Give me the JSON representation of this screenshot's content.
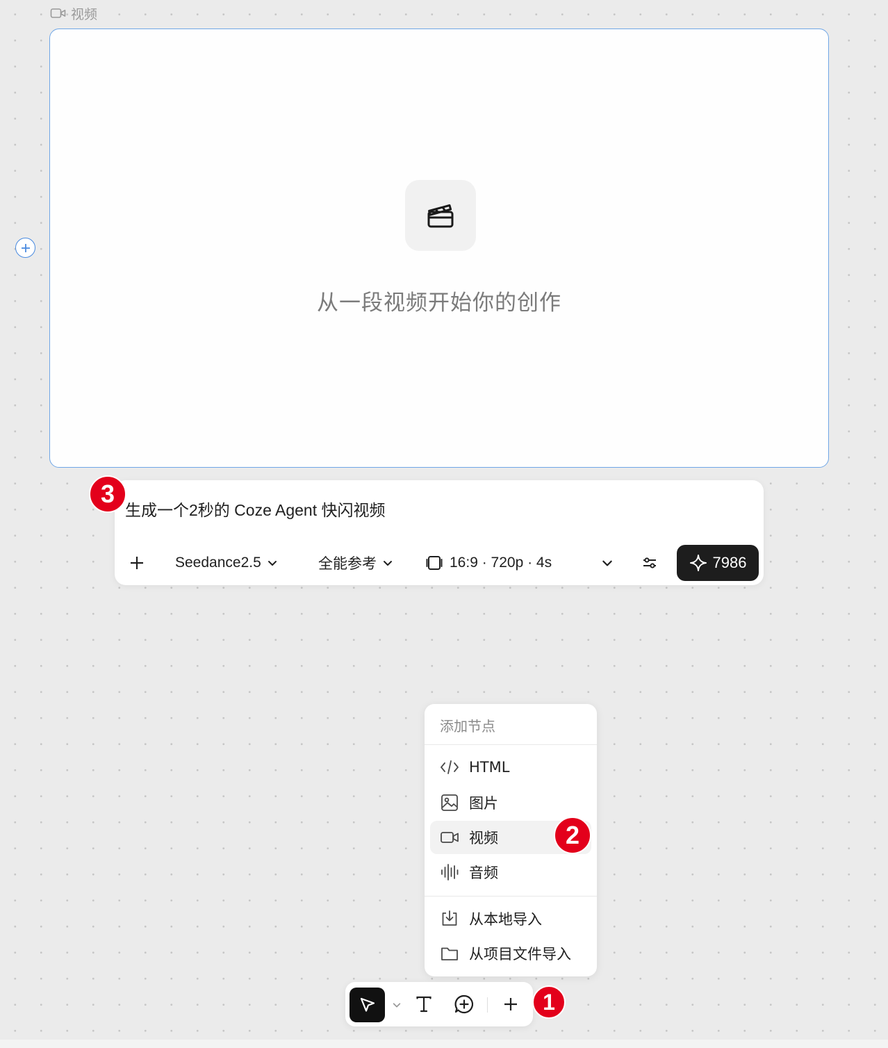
{
  "node": {
    "label": "视频",
    "placeholder_text": "从一段视频开始你的创作"
  },
  "prompt": {
    "text": "生成一个2秒的 Coze Agent 快闪视频",
    "model": "Seedance2.5",
    "reference_mode": "全能参考",
    "video_settings": "16:9 · 720p · 4s",
    "credits": "7986"
  },
  "add_menu": {
    "title": "添加节点",
    "items": [
      {
        "label": "HTML",
        "icon": "code-icon"
      },
      {
        "label": "图片",
        "icon": "image-icon"
      },
      {
        "label": "视频",
        "icon": "video-icon",
        "selected": true
      },
      {
        "label": "音频",
        "icon": "audio-wave-icon"
      }
    ],
    "import_items": [
      {
        "label": "从本地导入",
        "icon": "import-icon"
      },
      {
        "label": "从项目文件导入",
        "icon": "folder-icon"
      }
    ]
  },
  "markers": {
    "one": "1",
    "two": "2",
    "three": "3"
  },
  "colors": {
    "accent_blue": "#6fa6e6",
    "marker_red": "#e3001b",
    "button_dark": "#1d1d1d",
    "canvas_bg": "#ebebeb"
  }
}
